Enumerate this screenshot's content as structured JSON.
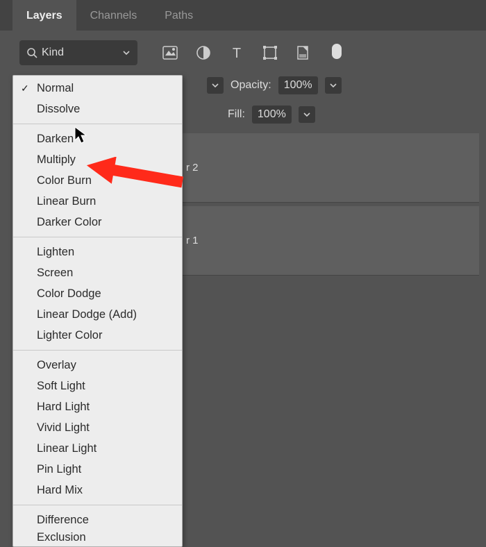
{
  "tabs": {
    "layers": "Layers",
    "channels": "Channels",
    "paths": "Paths"
  },
  "kind": {
    "label": "Kind"
  },
  "opacity": {
    "label": "Opacity:",
    "value": "100%"
  },
  "fill": {
    "label": "Fill:",
    "value": "100%"
  },
  "layers": [
    {
      "name": "r 2"
    },
    {
      "name": "r 1"
    }
  ],
  "blendModes": {
    "g1": [
      "Normal",
      "Dissolve"
    ],
    "g2": [
      "Darken",
      "Multiply",
      "Color Burn",
      "Linear Burn",
      "Darker Color"
    ],
    "g3": [
      "Lighten",
      "Screen",
      "Color Dodge",
      "Linear Dodge (Add)",
      "Lighter Color"
    ],
    "g4": [
      "Overlay",
      "Soft Light",
      "Hard Light",
      "Vivid Light",
      "Linear Light",
      "Pin Light",
      "Hard Mix"
    ],
    "g5": [
      "Difference",
      "Exclusion"
    ]
  },
  "selectedBlendMode": "Normal",
  "annotationTarget": "Multiply"
}
